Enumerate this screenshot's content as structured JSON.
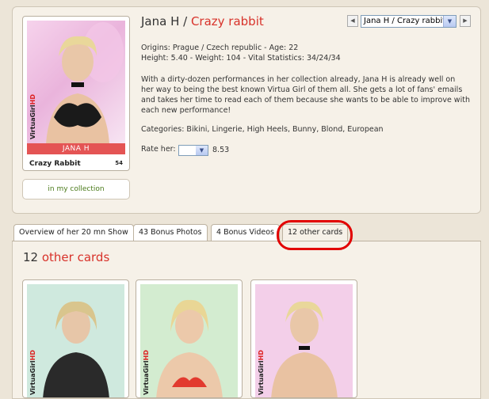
{
  "card": {
    "name_bar": "JANA H",
    "title": "Crazy Rabbit",
    "number": "54",
    "brand_main": "VirtuaGirl",
    "brand_suffix": "HD"
  },
  "collection_label": "in my collection",
  "header": {
    "name": "Jana H / ",
    "show": "Crazy rabbit",
    "select_value": "Jana H / Crazy rabbit",
    "prev_icon": "left-arrow-icon",
    "next_icon": "right-arrow-icon"
  },
  "info": {
    "origins": "Origins: Prague / Czech republic - Age: 22",
    "stats": "Height: 5.40 - Weight: 104 - Vital Statistics: 34/24/34",
    "description": "With a dirty-dozen performances in her collection already, Jana H is already well on her way to being the best known Virtua Girl of them all. She gets a lot of fans' emails and takes her time to read each of them because she wants to be able to improve with each new performance!",
    "categories": "Categories: Bikini, Lingerie, High Heels, Bunny, Blond, European",
    "rate_label": "Rate her:",
    "rating": "8.53"
  },
  "tabs": [
    {
      "label": "Overview of her 20 mn Show"
    },
    {
      "label": "43 Bonus Photos"
    },
    {
      "label": "4 Bonus Videos"
    },
    {
      "label": "12 other cards"
    }
  ],
  "section": {
    "count": "12 ",
    "label": "other cards"
  },
  "colors": {
    "accent": "#d8322a",
    "highlight": "#e20000",
    "collection_text": "#4a7a1a"
  }
}
